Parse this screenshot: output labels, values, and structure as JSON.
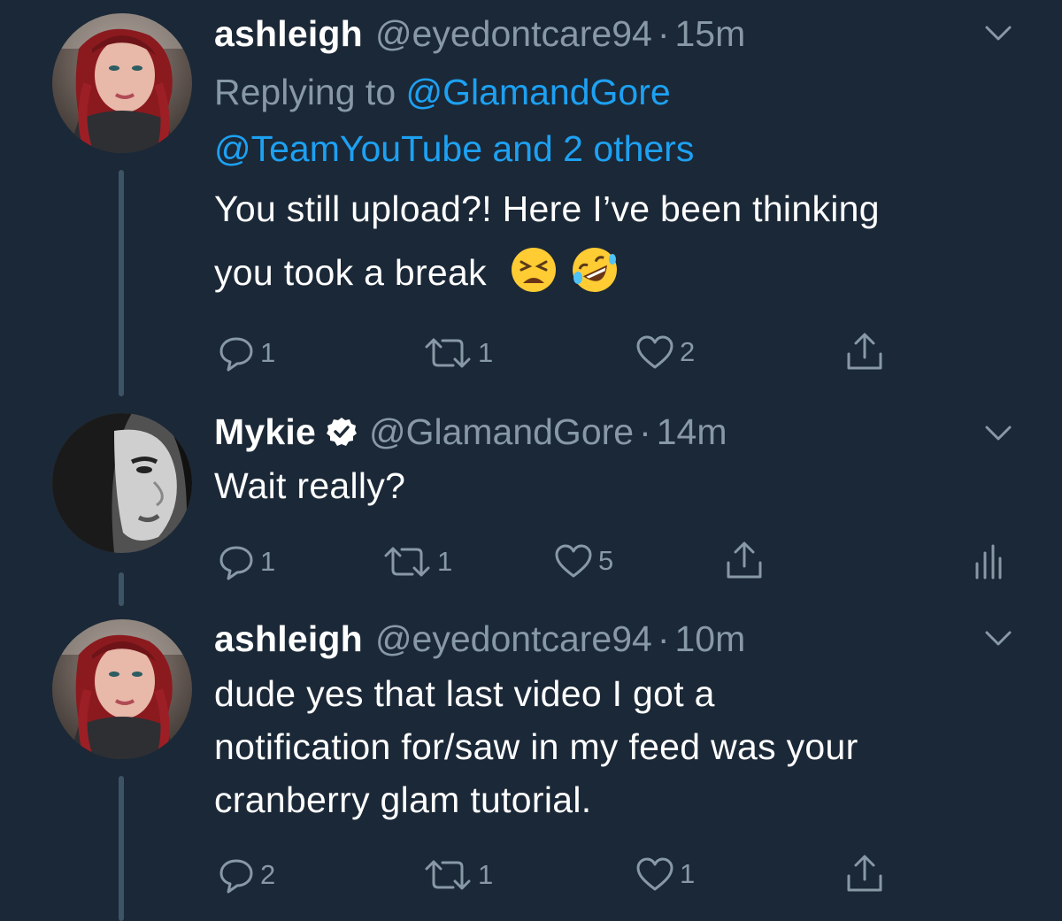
{
  "tweets": [
    {
      "name": "ashleigh",
      "handle": "@eyedontcare94",
      "dot": "·",
      "time": "15m",
      "replying_prefix": "Replying to",
      "replying_mention_1": "@GlamandGore",
      "replying_line_2": "@TeamYouTube and 2 others",
      "text_line_1": "You still upload?! Here I’ve been thinking",
      "text_line_2": "you took a break",
      "emojis": [
        "tired-face-emoji",
        "rolling-on-floor-laughing-emoji"
      ],
      "reply_count": "1",
      "retweet_count": "1",
      "like_count": "2"
    },
    {
      "name": "Mykie",
      "verified": true,
      "handle": "@GlamandGore",
      "dot": "·",
      "time": "14m",
      "text_line_1": "Wait really?",
      "reply_count": "1",
      "retweet_count": "1",
      "like_count": "5"
    },
    {
      "name": "ashleigh",
      "handle": "@eyedontcare94",
      "dot": "·",
      "time": "10m",
      "text_line_1": "dude yes that last video I got a",
      "text_line_2": "notification for/saw in my feed was your",
      "text_line_3": "cranberry glam tutorial.",
      "reply_count": "2",
      "retweet_count": "1",
      "like_count": "1"
    }
  ],
  "colors": {
    "background": "#1b2837",
    "primary_text": "#ffffff",
    "secondary_text": "#8899a6",
    "link": "#1da1f2",
    "thread_line": "#3d5466"
  },
  "icons": [
    "reply-icon",
    "retweet-icon",
    "like-icon",
    "share-icon",
    "analytics-icon",
    "caret-down-icon",
    "verified-badge-icon"
  ]
}
